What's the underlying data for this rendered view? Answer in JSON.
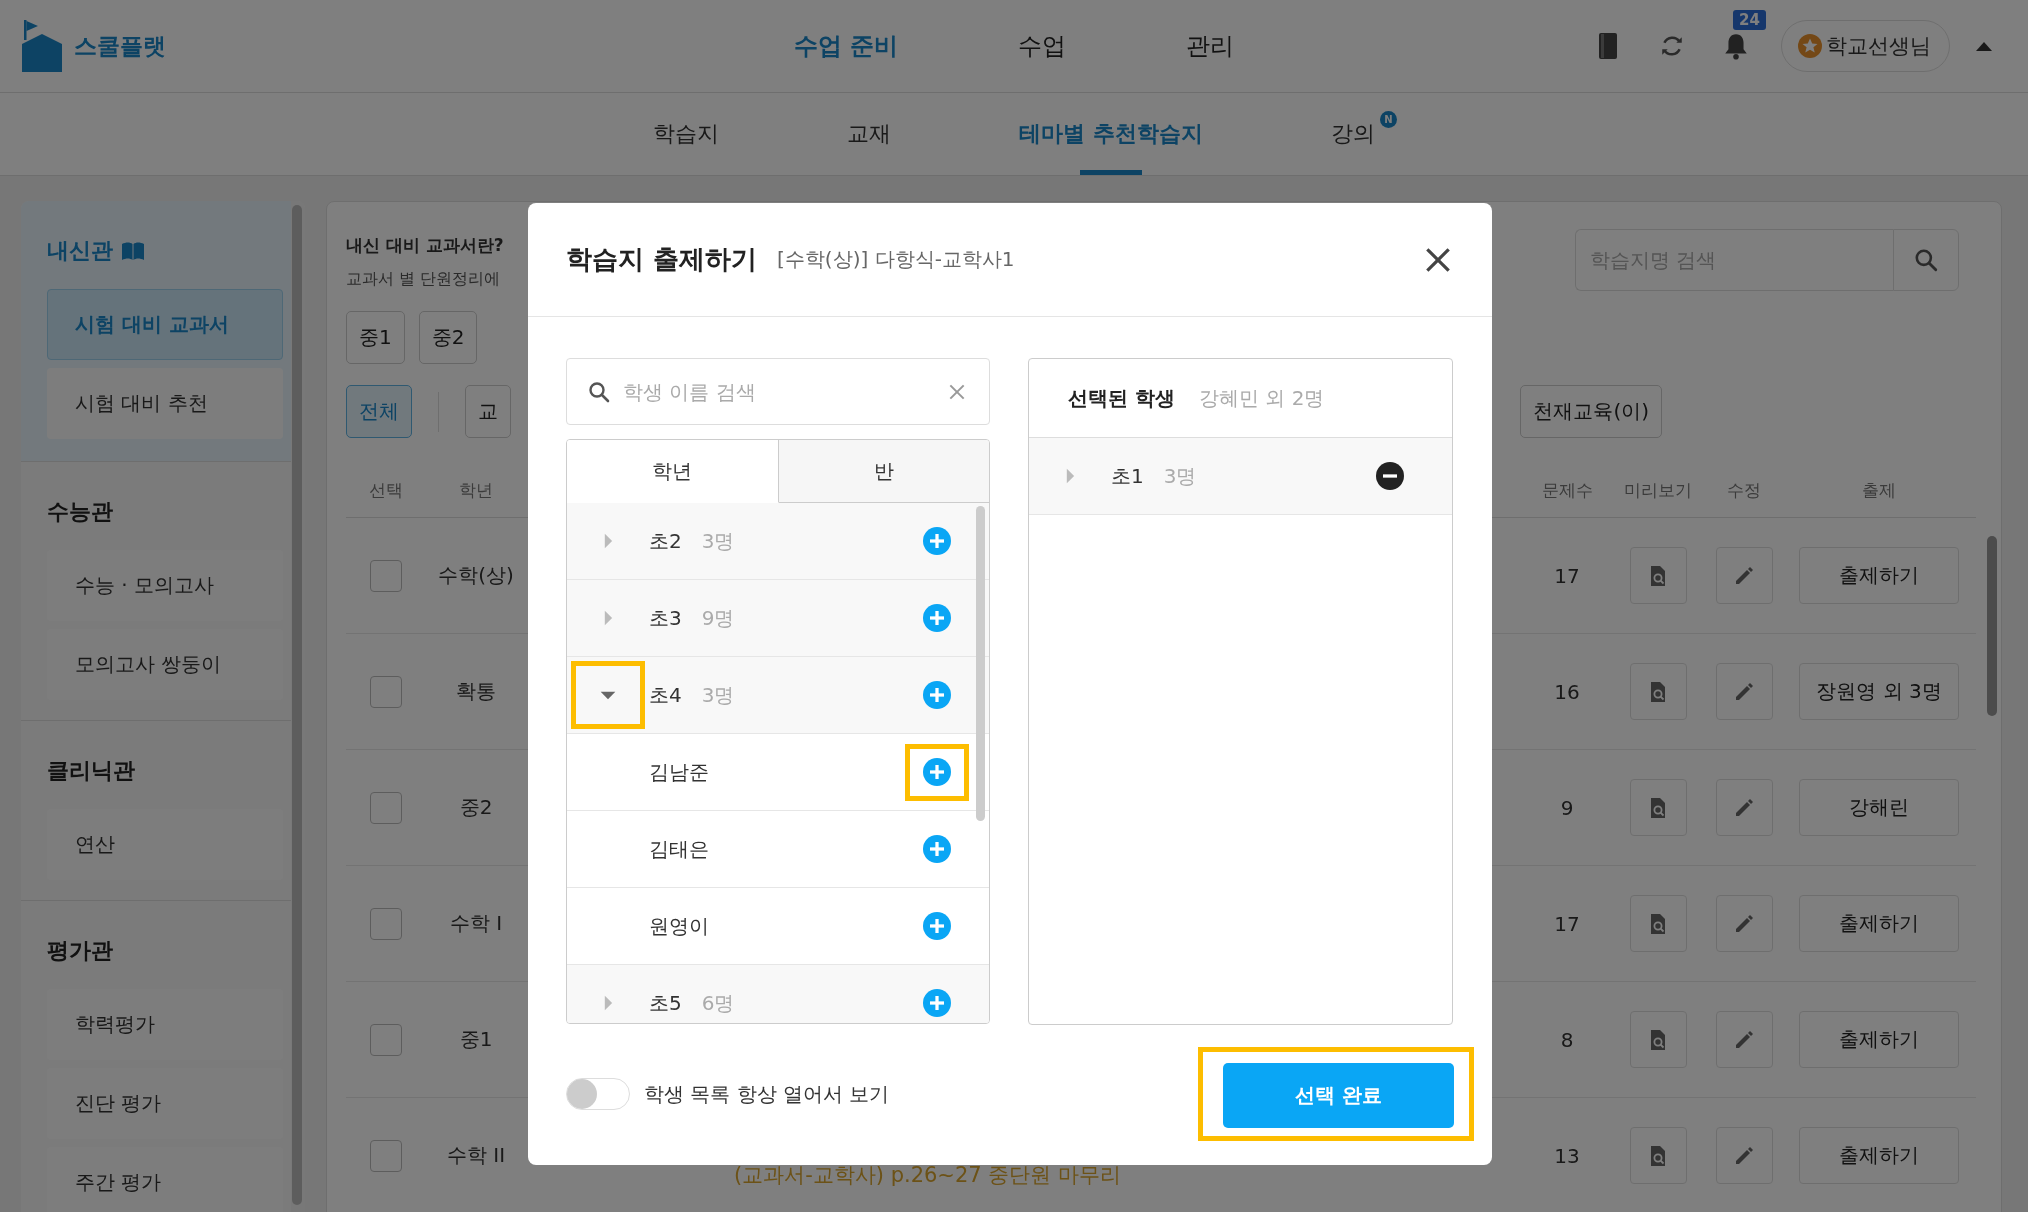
{
  "header": {
    "logo": "스쿨플랫",
    "nav": [
      {
        "label": "수업 준비",
        "selected": true
      },
      {
        "label": "수업",
        "selected": false
      },
      {
        "label": "관리",
        "selected": false
      }
    ],
    "notification_count": "24",
    "user": "학교선생님"
  },
  "subnav": [
    {
      "label": "학습지",
      "selected": false
    },
    {
      "label": "교재",
      "selected": false
    },
    {
      "label": "테마별 추천학습지",
      "selected": true
    },
    {
      "label": "강의",
      "selected": false,
      "badge": "N"
    }
  ],
  "sidebar": {
    "sections": [
      {
        "title": "내신관",
        "icon": true,
        "active": true,
        "items": [
          {
            "label": "시험 대비 교과서",
            "selected": true
          },
          {
            "label": "시험 대비 추천",
            "selected": false
          }
        ]
      },
      {
        "title": "수능관",
        "icon": false,
        "active": false,
        "items": [
          {
            "label": "수능 · 모의고사",
            "selected": false
          },
          {
            "label": "모의고사 쌍둥이",
            "selected": false
          }
        ]
      },
      {
        "title": "클리닉관",
        "icon": false,
        "active": false,
        "items": [
          {
            "label": "연산",
            "selected": false
          }
        ]
      },
      {
        "title": "평가관",
        "icon": false,
        "active": false,
        "items": [
          {
            "label": "학력평가",
            "selected": false
          },
          {
            "label": "진단 평가",
            "selected": false
          },
          {
            "label": "주간 평가",
            "selected": false
          }
        ]
      }
    ]
  },
  "main": {
    "intro_title": "내신 대비 교과서란?",
    "intro_text": "교과서 별 단원정리에",
    "search": {
      "placeholder": "학습지명 검색"
    },
    "grade_chips": [
      {
        "label": "중1",
        "selected": false
      },
      {
        "label": "중2",
        "selected": false
      }
    ],
    "publisher_chips": [
      {
        "label": "전체",
        "selected": true
      },
      {
        "label": "교",
        "selected": false
      }
    ],
    "publisher_chips_right": [
      {
        "label": "천재교육(이)",
        "selected": false
      }
    ],
    "table": {
      "columns": [
        "선택",
        "학년",
        "문제수",
        "미리보기",
        "수정",
        "출제"
      ],
      "rows": [
        {
          "checked": false,
          "grade": "수학(상)",
          "count": "17",
          "action": "출제하기"
        },
        {
          "checked": false,
          "grade": "확통",
          "count": "16",
          "action": "장원영 외 3명"
        },
        {
          "checked": false,
          "grade": "중2",
          "count": "9",
          "action": "강해린"
        },
        {
          "checked": false,
          "grade": "수학 I",
          "count": "17",
          "action": "출제하기"
        },
        {
          "checked": false,
          "grade": "중1",
          "count": "8",
          "action": "출제하기"
        },
        {
          "checked": false,
          "grade": "수학 II",
          "count": "13",
          "action": "출제하기",
          "title": "(교과서-교학사) p.26~27 중단원 마무리"
        }
      ]
    }
  },
  "modal": {
    "title": "학습지 출제하기",
    "subtitle": "[수학(상)] 다항식-교학사1",
    "search": {
      "placeholder": "학생 이름 검색"
    },
    "tabs": [
      {
        "label": "학년",
        "selected": true
      },
      {
        "label": "반",
        "selected": false
      }
    ],
    "groups": [
      {
        "label": "초2",
        "count": "3명",
        "expanded": false,
        "highlighted": false
      },
      {
        "label": "초3",
        "count": "9명",
        "expanded": false,
        "highlighted": false
      },
      {
        "label": "초4",
        "count": "3명",
        "expanded": true,
        "highlighted": true,
        "children": [
          {
            "name": "김남준",
            "highlighted": true
          },
          {
            "name": "김태은",
            "highlighted": false
          },
          {
            "name": "원영이",
            "highlighted": false
          }
        ]
      },
      {
        "label": "초5",
        "count": "6명",
        "expanded": false,
        "highlighted": false
      }
    ],
    "selected_title": "선택된 학생",
    "selected_summary": "강혜민 외 2명",
    "selected_groups": [
      {
        "label": "초1",
        "count": "3명",
        "expanded": false
      }
    ],
    "toggle": {
      "label": "학생 목록 항상 열어서 보기",
      "on": false
    },
    "confirm": {
      "label": "선택 완료",
      "highlighted": true
    }
  }
}
